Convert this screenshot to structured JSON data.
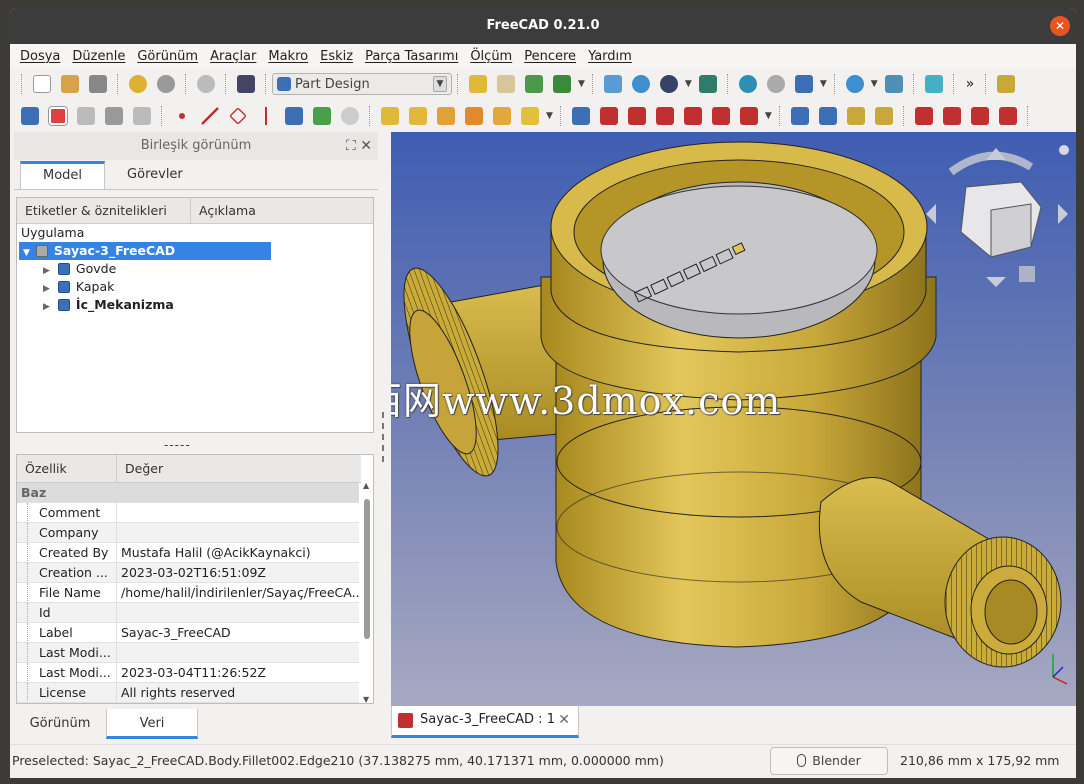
{
  "window": {
    "title": "FreeCAD 0.21.0",
    "close_icon": "close-icon"
  },
  "menu": [
    "Dosya",
    "Düzenle",
    "Görünüm",
    "Araçlar",
    "Makro",
    "Eskiz",
    "Parça Tasarımı",
    "Ölçüm",
    "Pencere",
    "Yardım"
  ],
  "toolbar": {
    "workbench": "Part Design",
    "overflow": "»"
  },
  "combo": {
    "title": "Birleşik görünüm",
    "tabs": [
      "Model",
      "Görevler"
    ],
    "tree_headers": [
      "Etiketler & öznitelikleri",
      "Açıklama"
    ],
    "tree_root": "Uygulama",
    "document": "Sayac-3_FreeCAD",
    "bodies": [
      "Govde",
      "Kapak",
      "İc_Mekanizma"
    ],
    "splitter": "-----",
    "prop_headers": [
      "Özellik",
      "Değer"
    ],
    "prop_group": "Baz",
    "properties": [
      {
        "k": "Comment",
        "v": ""
      },
      {
        "k": "Company",
        "v": ""
      },
      {
        "k": "Created By",
        "v": "Mustafa Halil (@AcikKaynakci)"
      },
      {
        "k": "Creation ...",
        "v": "2023-03-02T16:51:09Z"
      },
      {
        "k": "File Name",
        "v": "/home/halil/İndirilenler/Sayaç/FreeCA..."
      },
      {
        "k": "Id",
        "v": ""
      },
      {
        "k": "Label",
        "v": "Sayac-3_FreeCAD"
      },
      {
        "k": "Last Modi...",
        "v": ""
      },
      {
        "k": "Last Modi...",
        "v": "2023-03-04T11:26:52Z"
      },
      {
        "k": "License",
        "v": "All rights reserved"
      }
    ],
    "bottom_tabs": [
      "Görünüm",
      "Veri"
    ]
  },
  "viewport": {
    "watermark": "莫西网www.3dmox.com",
    "gradient_top": "#3f5db2",
    "gradient_bottom": "#a7a9c1",
    "model_color": "#c8a83a"
  },
  "doc_tab": "Sayac-3_FreeCAD : 1",
  "status": {
    "preselected": "Preselected: Sayac_2_FreeCAD.Body.Fillet002.Edge210 (37.138275 mm, 40.171371 mm, 0.000000 mm)",
    "nav_style": "Blender",
    "dimensions": "210,86 mm x 175,92 mm"
  }
}
